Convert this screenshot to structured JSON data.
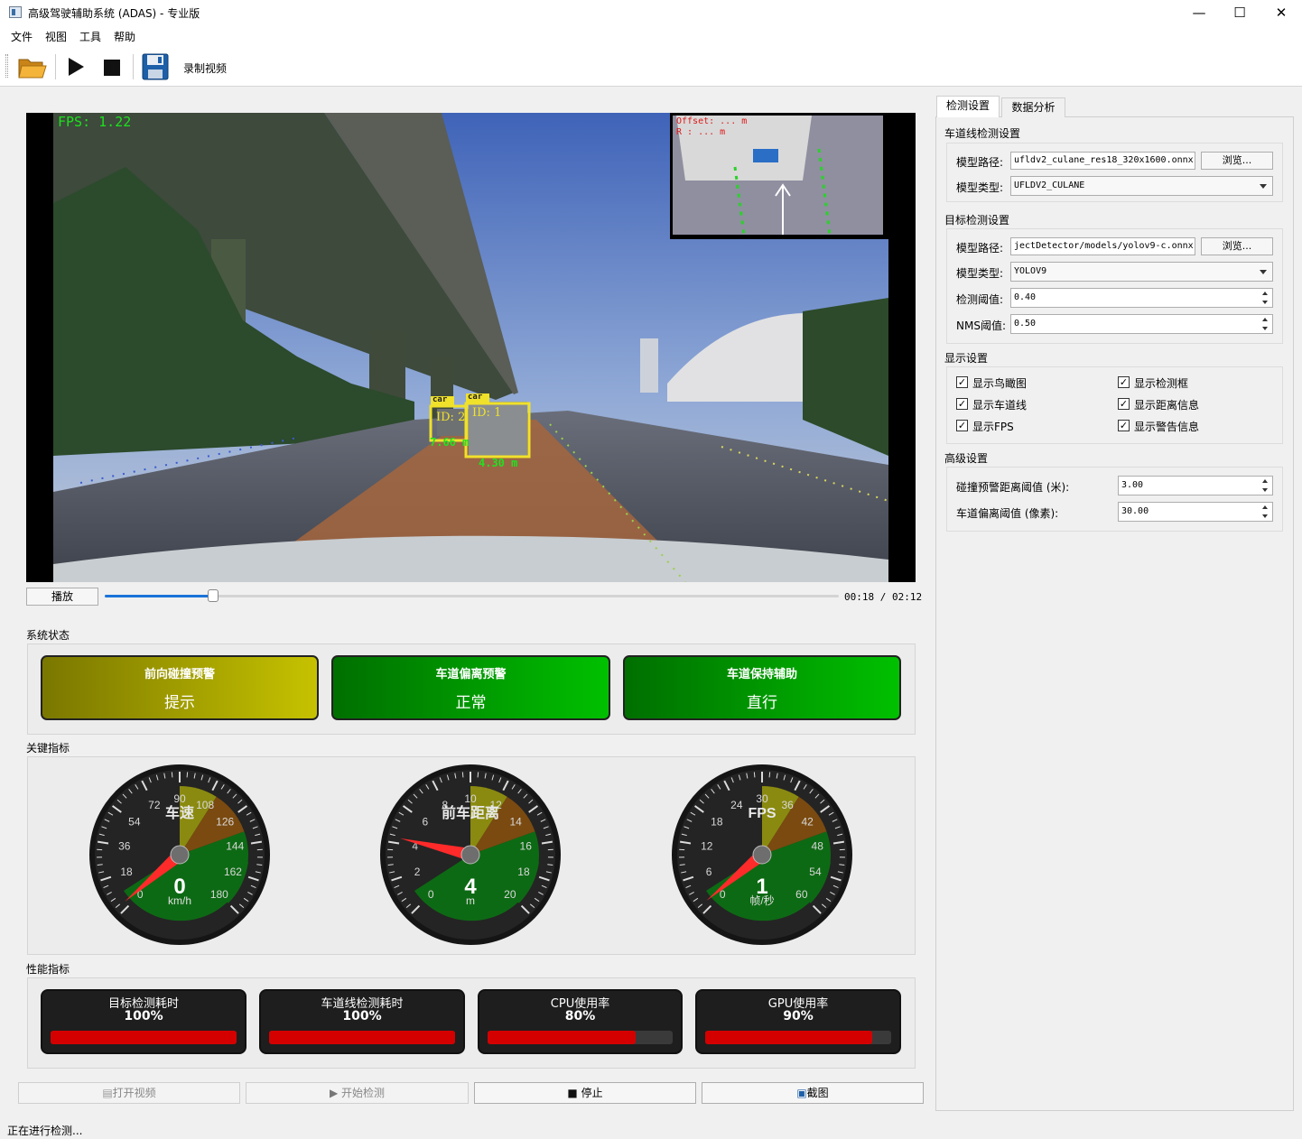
{
  "window": {
    "title": "高级驾驶辅助系统 (ADAS) - 专业版",
    "minimize": "—",
    "maximize": "☐",
    "close": "✕"
  },
  "menu": [
    "文件",
    "视图",
    "工具",
    "帮助"
  ],
  "toolbar": {
    "open_icon": "folder-open-icon",
    "play_icon": "play-icon",
    "stop_icon": "stop-icon",
    "save_icon": "save-icon",
    "record_label": "录制视频"
  },
  "video": {
    "fps_text": "FPS: 1.22",
    "birdseye_offset": "Offset: ... m",
    "birdseye_radius": "R : ... m",
    "detections": [
      {
        "label": "car",
        "id": "ID: 2",
        "distance": "7.66 m"
      },
      {
        "label": "car",
        "id": "ID: 1",
        "distance": "4.30 m"
      }
    ]
  },
  "playback": {
    "play_button": "播放",
    "progress": 0.148,
    "time": "00:18 / 02:12"
  },
  "system_status": {
    "title": "系统状态",
    "cards": [
      {
        "title": "前向碰撞预警",
        "value": "提示",
        "color_from": "#7a7700",
        "color_to": "#c6c200"
      },
      {
        "title": "车道偏离预警",
        "value": "正常",
        "color_from": "#006f00",
        "color_to": "#00c000"
      },
      {
        "title": "车道保持辅助",
        "value": "直行",
        "color_from": "#006f00",
        "color_to": "#00c000"
      }
    ]
  },
  "key_metrics": {
    "title": "关键指标",
    "gauges": [
      {
        "title": "车速",
        "value": "0",
        "unit": "km/h",
        "min": 0,
        "max": 180,
        "reading": 3,
        "ticks": [
          "0",
          "18",
          "36",
          "54",
          "72",
          "90",
          "108",
          "126",
          "144",
          "162",
          "180"
        ]
      },
      {
        "title": "前车距离",
        "value": "4",
        "unit": "m",
        "min": 0,
        "max": 20,
        "reading": 4.3,
        "ticks": [
          "0",
          "2",
          "4",
          "6",
          "8",
          "10",
          "12",
          "14",
          "16",
          "18",
          "20"
        ]
      },
      {
        "title": "FPS",
        "value": "1",
        "unit": "帧/秒",
        "min": 0,
        "max": 60,
        "reading": 1.2,
        "ticks": [
          "0",
          "6",
          "12",
          "18",
          "24",
          "30",
          "36",
          "42",
          "48",
          "54",
          "60"
        ]
      }
    ]
  },
  "performance": {
    "title": "性能指标",
    "items": [
      {
        "title": "目标检测耗时",
        "value": "100%",
        "fill": 1.0
      },
      {
        "title": "车道线检测耗时",
        "value": "100%",
        "fill": 1.0
      },
      {
        "title": "CPU使用率",
        "value": "80%",
        "fill": 0.8
      },
      {
        "title": "GPU使用率",
        "value": "90%",
        "fill": 0.9
      }
    ]
  },
  "bottom_buttons": [
    "打开视频",
    "开始检测",
    "停止",
    "截图"
  ],
  "right": {
    "tabs": [
      "检测设置",
      "数据分析"
    ],
    "lane": {
      "title": "车道线检测设置",
      "model_path_label": "模型路径:",
      "model_path": "ufldv2_culane_res18_320x1600.onnx",
      "browse": "浏览...",
      "model_type_label": "模型类型:",
      "model_type": "UFLDV2_CULANE"
    },
    "object": {
      "title": "目标检测设置",
      "model_path_label": "模型路径:",
      "model_path": "jectDetector/models/yolov9-c.onnx",
      "browse": "浏览...",
      "model_type_label": "模型类型:",
      "model_type": "YOLOV9",
      "threshold_label": "检测阈值:",
      "threshold": "0.40",
      "nms_label": "NMS阈值:",
      "nms": "0.50"
    },
    "display": {
      "title": "显示设置",
      "options": [
        {
          "label": "显示鸟瞰图",
          "checked": true
        },
        {
          "label": "显示检测框",
          "checked": true
        },
        {
          "label": "显示车道线",
          "checked": true
        },
        {
          "label": "显示距离信息",
          "checked": true
        },
        {
          "label": "显示FPS",
          "checked": true
        },
        {
          "label": "显示警告信息",
          "checked": true
        }
      ]
    },
    "advanced": {
      "title": "高级设置",
      "collision_label": "碰撞预警距离阈值 (米):",
      "collision": "3.00",
      "lane_dev_label": "车道偏离阈值 (像素):",
      "lane_dev": "30.00"
    }
  },
  "status_bar": "正在进行检测..."
}
